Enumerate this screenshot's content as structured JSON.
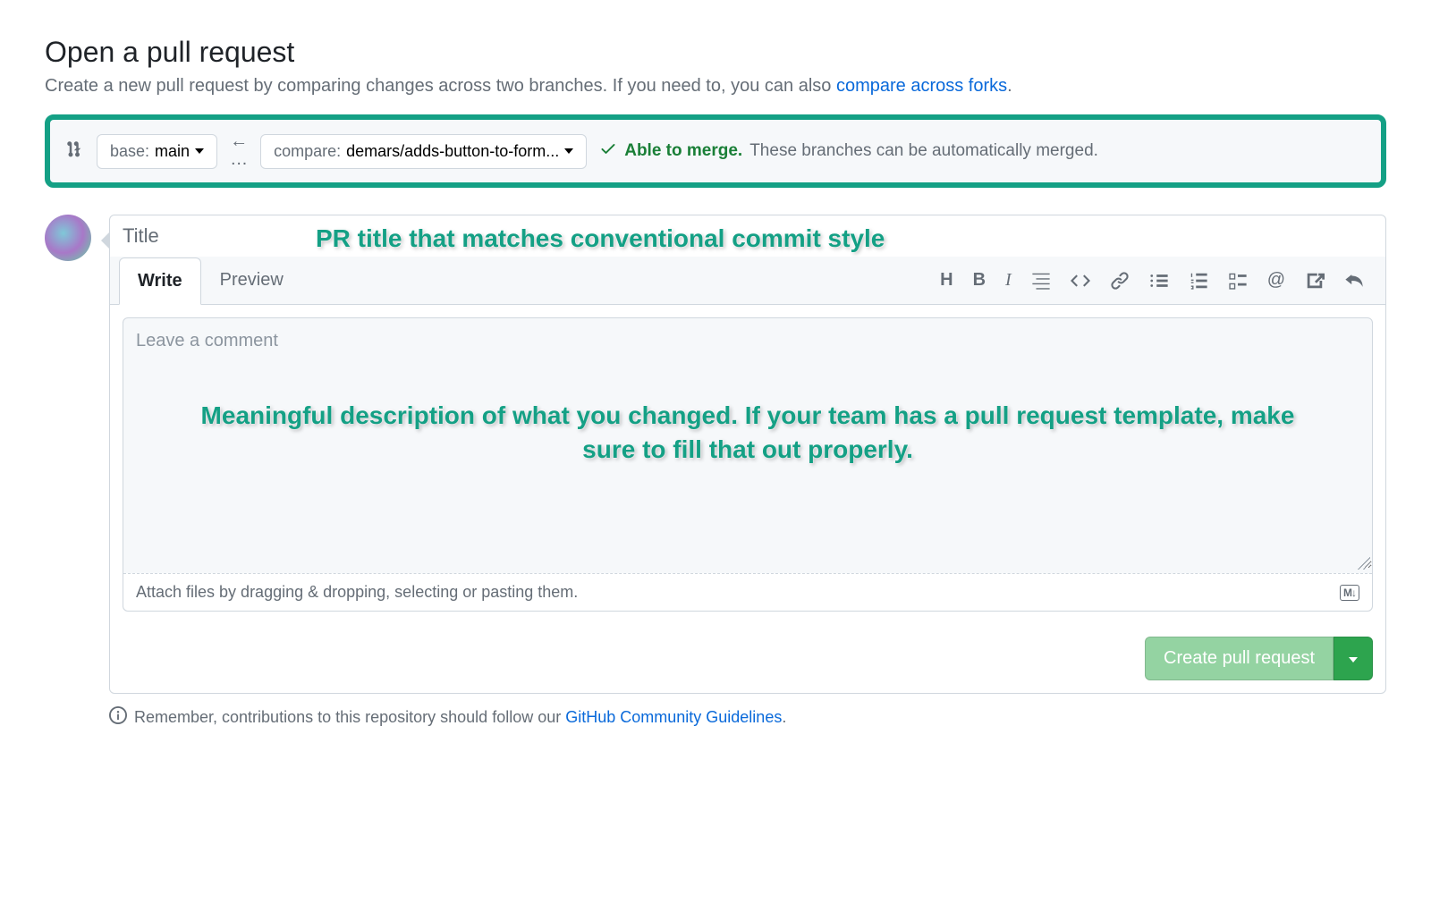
{
  "header": {
    "title": "Open a pull request",
    "subtitle_prefix": "Create a new pull request by comparing changes across two branches. If you need to, you can also ",
    "subtitle_link": "compare across forks",
    "subtitle_suffix": "."
  },
  "branch_selector": {
    "base_label": "base:",
    "base_value": "main",
    "compare_label": "compare:",
    "compare_value": "demars/adds-button-to-form...",
    "merge_status": "Able to merge.",
    "merge_detail": "These branches can be automatically merged."
  },
  "pr_form": {
    "title_label": "Title",
    "title_value": "",
    "tabs": {
      "write": "Write",
      "preview": "Preview"
    },
    "comment_placeholder": "Leave a comment",
    "comment_value": "",
    "attach_hint": "Attach files by dragging & dropping, selecting or pasting them.",
    "markdown_badge": "M↓",
    "create_button": "Create pull request"
  },
  "footer": {
    "prefix": "Remember, contributions to this repository should follow our ",
    "link": "GitHub Community Guidelines",
    "suffix": "."
  },
  "annotations": {
    "title_hint": "PR title that matches conventional commit style",
    "body_hint": "Meaningful description of what you changed. If your team has a pull request template, make sure to fill that out properly."
  }
}
